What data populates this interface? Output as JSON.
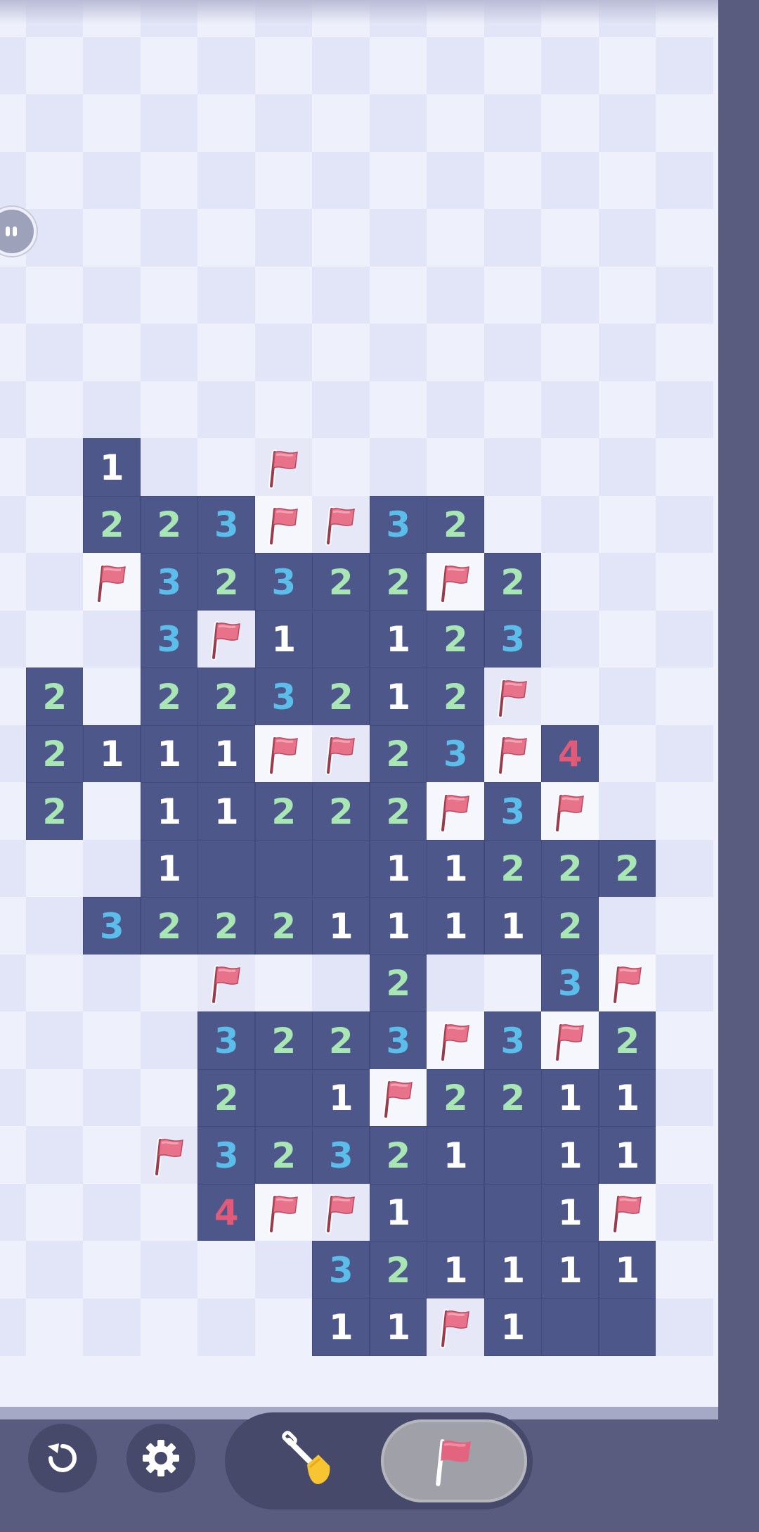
{
  "board": {
    "rows_visible": 24,
    "cols_visible": 12,
    "row_offset": -0.35,
    "col_offset": -0.55,
    "revealed": [
      [
        8,
        2,
        "1"
      ],
      [
        9,
        2,
        "2"
      ],
      [
        9,
        3,
        "2"
      ],
      [
        9,
        4,
        "3"
      ],
      [
        9,
        7,
        "3"
      ],
      [
        9,
        8,
        "2"
      ],
      [
        10,
        3,
        "3"
      ],
      [
        10,
        4,
        "2"
      ],
      [
        10,
        5,
        "3"
      ],
      [
        10,
        6,
        "2"
      ],
      [
        10,
        7,
        "2"
      ],
      [
        10,
        9,
        "2"
      ],
      [
        11,
        3,
        "3"
      ],
      [
        11,
        5,
        "1"
      ],
      [
        11,
        6,
        ""
      ],
      [
        11,
        7,
        "1"
      ],
      [
        11,
        8,
        "2"
      ],
      [
        11,
        9,
        "3"
      ],
      [
        12,
        1,
        "2"
      ],
      [
        12,
        3,
        "2"
      ],
      [
        12,
        4,
        "2"
      ],
      [
        12,
        5,
        "3"
      ],
      [
        12,
        6,
        "2"
      ],
      [
        12,
        7,
        "1"
      ],
      [
        12,
        8,
        "2"
      ],
      [
        13,
        1,
        "2"
      ],
      [
        13,
        2,
        "1"
      ],
      [
        13,
        3,
        "1"
      ],
      [
        13,
        4,
        "1"
      ],
      [
        13,
        7,
        "2"
      ],
      [
        13,
        8,
        "3"
      ],
      [
        13,
        10,
        "4"
      ],
      [
        14,
        1,
        "2"
      ],
      [
        14,
        3,
        "1"
      ],
      [
        14,
        4,
        "1"
      ],
      [
        14,
        5,
        "2"
      ],
      [
        14,
        6,
        "2"
      ],
      [
        14,
        7,
        "2"
      ],
      [
        14,
        9,
        "3"
      ],
      [
        15,
        3,
        "1"
      ],
      [
        15,
        4,
        ""
      ],
      [
        15,
        5,
        ""
      ],
      [
        15,
        6,
        ""
      ],
      [
        15,
        7,
        "1"
      ],
      [
        15,
        8,
        "1"
      ],
      [
        15,
        9,
        "2"
      ],
      [
        15,
        10,
        "2"
      ],
      [
        15,
        11,
        "2"
      ],
      [
        16,
        2,
        "3"
      ],
      [
        16,
        3,
        "2"
      ],
      [
        16,
        4,
        "2"
      ],
      [
        16,
        5,
        "2"
      ],
      [
        16,
        6,
        "1"
      ],
      [
        16,
        7,
        "1"
      ],
      [
        16,
        8,
        "1"
      ],
      [
        16,
        9,
        "1"
      ],
      [
        16,
        10,
        "2"
      ],
      [
        17,
        7,
        "2"
      ],
      [
        17,
        10,
        "3"
      ],
      [
        18,
        4,
        "3"
      ],
      [
        18,
        5,
        "2"
      ],
      [
        18,
        6,
        "2"
      ],
      [
        18,
        7,
        "3"
      ],
      [
        18,
        9,
        "3"
      ],
      [
        18,
        11,
        "2"
      ],
      [
        19,
        4,
        "2"
      ],
      [
        19,
        5,
        ""
      ],
      [
        19,
        6,
        "1"
      ],
      [
        19,
        8,
        "2"
      ],
      [
        19,
        9,
        "2"
      ],
      [
        19,
        10,
        "1"
      ],
      [
        19,
        11,
        "1"
      ],
      [
        20,
        4,
        "3"
      ],
      [
        20,
        5,
        "2"
      ],
      [
        20,
        6,
        "3"
      ],
      [
        20,
        7,
        "2"
      ],
      [
        20,
        8,
        "1"
      ],
      [
        20,
        9,
        ""
      ],
      [
        20,
        10,
        "1"
      ],
      [
        20,
        11,
        "1"
      ],
      [
        21,
        4,
        "4"
      ],
      [
        21,
        7,
        "1"
      ],
      [
        21,
        8,
        ""
      ],
      [
        21,
        9,
        ""
      ],
      [
        21,
        10,
        "1"
      ],
      [
        22,
        6,
        "3"
      ],
      [
        22,
        7,
        "2"
      ],
      [
        22,
        8,
        "1"
      ],
      [
        22,
        9,
        "1"
      ],
      [
        22,
        10,
        "1"
      ],
      [
        22,
        11,
        "1"
      ],
      [
        23,
        6,
        "1"
      ],
      [
        23,
        7,
        "1"
      ],
      [
        23,
        9,
        "1"
      ],
      [
        23,
        10,
        ""
      ],
      [
        23,
        11,
        ""
      ]
    ],
    "flags": [
      [
        8,
        5
      ],
      [
        9,
        5
      ],
      [
        9,
        6
      ],
      [
        10,
        2
      ],
      [
        10,
        8
      ],
      [
        11,
        4
      ],
      [
        12,
        9
      ],
      [
        13,
        5
      ],
      [
        13,
        6
      ],
      [
        13,
        9
      ],
      [
        14,
        8
      ],
      [
        14,
        10
      ],
      [
        17,
        4
      ],
      [
        17,
        11
      ],
      [
        18,
        8
      ],
      [
        18,
        10
      ],
      [
        19,
        7
      ],
      [
        20,
        3
      ],
      [
        21,
        5
      ],
      [
        21,
        6
      ],
      [
        21,
        11
      ],
      [
        23,
        8
      ]
    ]
  },
  "number_colors": {
    "1": "#ffffff",
    "2": "#a8e6b4",
    "3": "#5bbde9",
    "4": "#e15a78"
  },
  "toolbar": {
    "restart_icon": "restart-icon",
    "settings_icon": "gear-icon",
    "dig_icon": "shovel-icon",
    "flag_icon": "flag-icon",
    "active_tool": "flag"
  }
}
